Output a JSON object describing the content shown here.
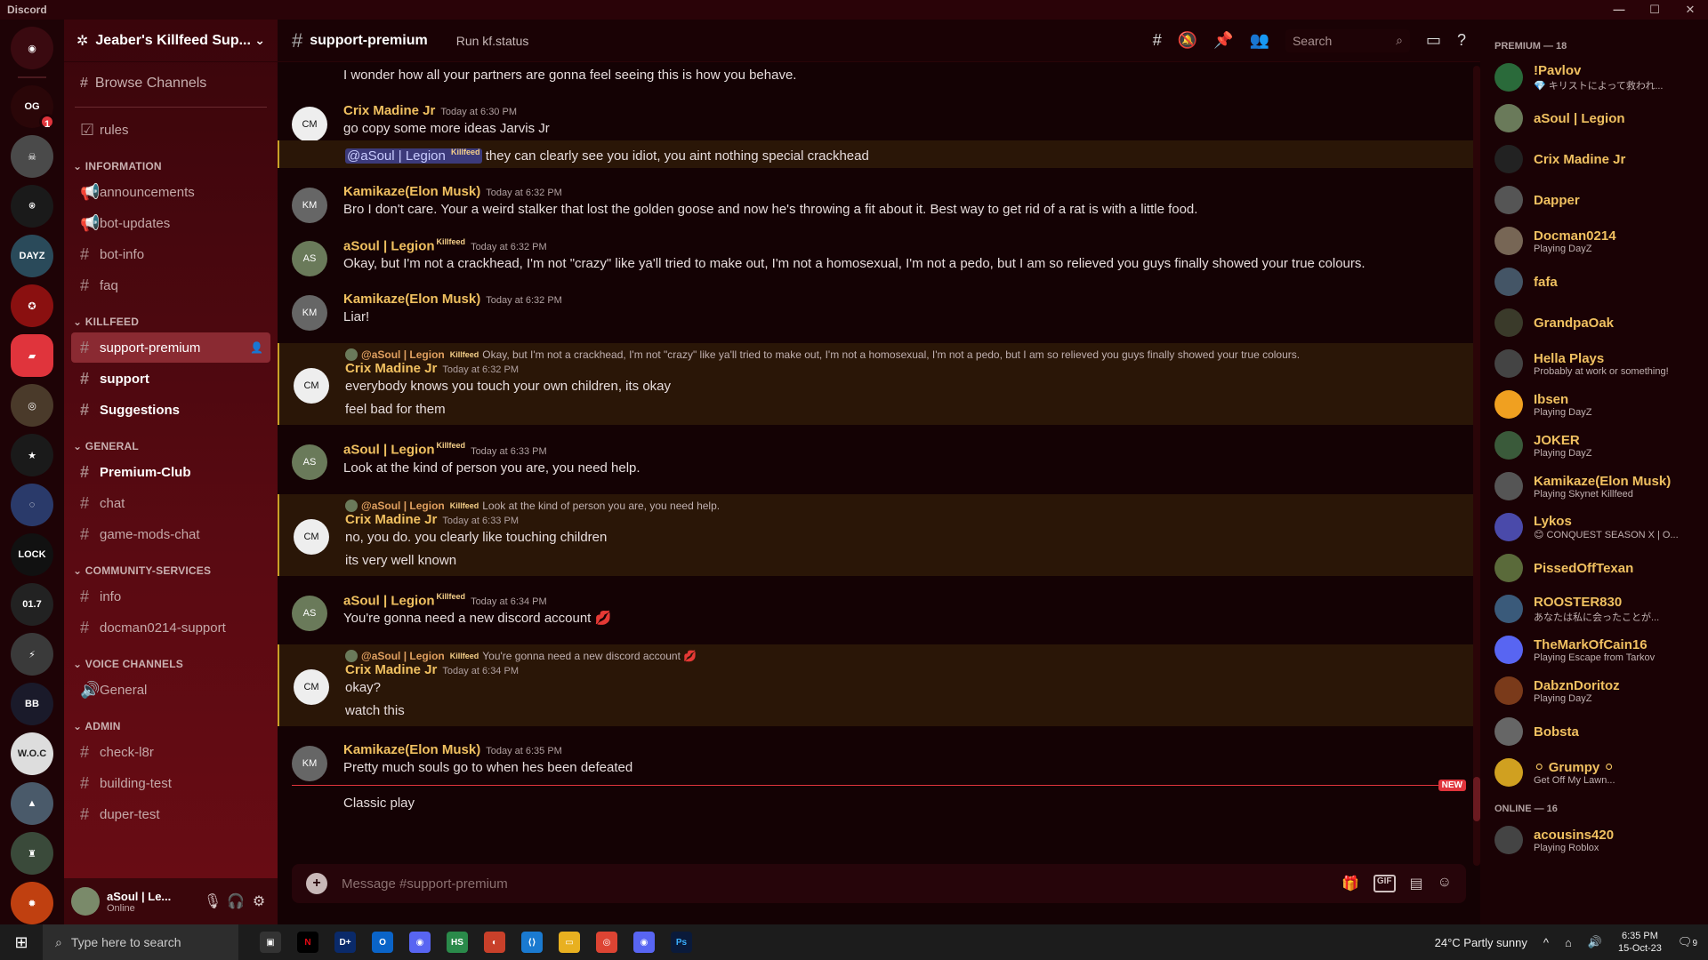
{
  "window": {
    "title": "Discord"
  },
  "server": {
    "name": "Jeaber's Killfeed Sup..."
  },
  "sidebar": {
    "browse": "Browse Channels",
    "rules": "rules",
    "categories": [
      {
        "name": "INFORMATION",
        "channels": [
          "announcements",
          "bot-updates",
          "bot-info",
          "faq"
        ]
      },
      {
        "name": "KILLFEED",
        "channels": [
          "support-premium",
          "support",
          "Suggestions"
        ]
      },
      {
        "name": "GENERAL",
        "channels": [
          "Premium-Club",
          "chat",
          "game-mods-chat"
        ]
      },
      {
        "name": "COMMUNITY-SERVICES",
        "channels": [
          "info",
          "docman0214-support"
        ]
      },
      {
        "name": "VOICE CHANNELS",
        "channels": [
          "General"
        ]
      },
      {
        "name": "ADMIN",
        "channels": [
          "check-l8r",
          "building-test",
          "duper-test"
        ]
      }
    ]
  },
  "user": {
    "name": "aSoul | Le...",
    "status": "Online"
  },
  "channel": {
    "name": "support-premium",
    "topic": "Run kf.status"
  },
  "search": {
    "placeholder": "Search"
  },
  "messages": {
    "m0": {
      "text": "I wonder how all your partners are gonna feel seeing this is how you behave."
    },
    "m1": {
      "author": "Crix Madine Jr",
      "ts": "Today at 6:30 PM",
      "text": "go copy some more ideas Jarvis Jr"
    },
    "m1b": {
      "mention": "@aSoul | Legion",
      "tag": "Killfeed",
      "text": " they can clearly see you idiot, you aint nothing special crackhead"
    },
    "m2": {
      "author": "Kamikaze(Elon Musk)",
      "ts": "Today at 6:32 PM",
      "text": "Bro I don't care. Your a weird stalker that lost the golden goose and now he's throwing a fit about it. Best way to get rid of a rat is with a little food."
    },
    "m3": {
      "author": "aSoul | Legion",
      "tag": "Killfeed",
      "ts": "Today at 6:32 PM",
      "text": "Okay, but I'm not a crackhead, I'm not \"crazy\" like ya'll tried to make out, I'm not a homosexual, I'm not a pedo, but I am so relieved you guys finally showed your true colours."
    },
    "m4": {
      "author": "Kamikaze(Elon Musk)",
      "ts": "Today at 6:32 PM",
      "text": "Liar!"
    },
    "m5": {
      "reply_name": "@aSoul | Legion",
      "reply_tag": "Killfeed",
      "reply_text": "Okay, but I'm not a crackhead, I'm not \"crazy\" like ya'll tried to make out, I'm not a homosexual, I'm not a pedo, but I am so relieved you guys finally showed your true colours.",
      "author": "Crix Madine Jr",
      "ts": "Today at 6:32 PM",
      "text": "everybody knows you touch your own children, its okay",
      "text2": "feel bad for them"
    },
    "m6": {
      "author": "aSoul | Legion",
      "tag": "Killfeed",
      "ts": "Today at 6:33 PM",
      "text": "Look at the kind of person you are, you need help."
    },
    "m7": {
      "reply_name": "@aSoul | Legion",
      "reply_tag": "Killfeed",
      "reply_text": "Look at the kind of person you are, you need help.",
      "author": "Crix Madine Jr",
      "ts": "Today at 6:33 PM",
      "text": "no, you do. you clearly like touching children",
      "text2": "its very well known"
    },
    "m8": {
      "author": "aSoul | Legion",
      "tag": "Killfeed",
      "ts": "Today at 6:34 PM",
      "text": "You're gonna need a new discord account 💋"
    },
    "m9": {
      "reply_name": "@aSoul | Legion",
      "reply_tag": "Killfeed",
      "reply_text": "You're gonna need a new discord account 💋",
      "author": "Crix Madine Jr",
      "ts": "Today at 6:34 PM",
      "text": "okay?",
      "text2": "watch this"
    },
    "m10": {
      "author": "Kamikaze(Elon Musk)",
      "ts": "Today at 6:35 PM",
      "text": "Pretty much souls go to when hes been defeated",
      "text2": "Classic play"
    },
    "new_label": "NEW"
  },
  "composer": {
    "placeholder": "Message #support-premium",
    "gif": "GIF"
  },
  "members": {
    "premium_header": "PREMIUM — 18",
    "online_header": "ONLINE — 16",
    "list": [
      {
        "name": "!Pavlov",
        "activity": "💎 キリストによって救われ...",
        "color": "#2a6a3a"
      },
      {
        "name": "aSoul | Legion",
        "activity": "",
        "color": "#6a7a5a"
      },
      {
        "name": "Crix Madine Jr",
        "activity": "",
        "color": "#222"
      },
      {
        "name": "Dapper",
        "activity": "",
        "color": "#555"
      },
      {
        "name": "Docman0214",
        "activity": "Playing DayZ",
        "color": "#776655"
      },
      {
        "name": "fafa",
        "activity": "",
        "color": "#445566"
      },
      {
        "name": "GrandpaOak",
        "activity": "",
        "color": "#3a3a2a"
      },
      {
        "name": "Hella Plays",
        "activity": "Probably at work or something!",
        "color": "#444"
      },
      {
        "name": "Ibsen",
        "activity": "Playing DayZ",
        "color": "#f0a020"
      },
      {
        "name": "JOKER",
        "activity": "Playing DayZ",
        "color": "#3a5a3a"
      },
      {
        "name": "Kamikaze(Elon Musk)",
        "activity": "Playing Skynet Killfeed",
        "color": "#555"
      },
      {
        "name": "Lykos",
        "activity": "😊 CONQUEST SEASON X | O...",
        "color": "#4a4aaa"
      },
      {
        "name": "PissedOffTexan",
        "activity": "",
        "color": "#5a6a3a"
      },
      {
        "name": "ROOSTER830",
        "activity": "あなたは私に会ったことが...",
        "color": "#3a5a7a"
      },
      {
        "name": "TheMarkOfCain16",
        "activity": "Playing Escape from Tarkov",
        "color": "#5865f2"
      },
      {
        "name": "DabznDoritoz",
        "activity": "Playing DayZ",
        "color": "#7a3a1a"
      },
      {
        "name": "Bobsta",
        "activity": "",
        "color": "#666"
      },
      {
        "name": "⚪ Grumpy ⚪",
        "activity": "Get Off My Lawn...",
        "color": "#d0a020"
      }
    ],
    "online_list": [
      {
        "name": "acousins420",
        "activity": "Playing Roblox",
        "color": "#444"
      }
    ]
  },
  "taskbar": {
    "search": "Type here to search",
    "weather": "24°C  Partly sunny",
    "time": "6:35 PM",
    "date": "15-Oct-23",
    "notif": "9"
  }
}
